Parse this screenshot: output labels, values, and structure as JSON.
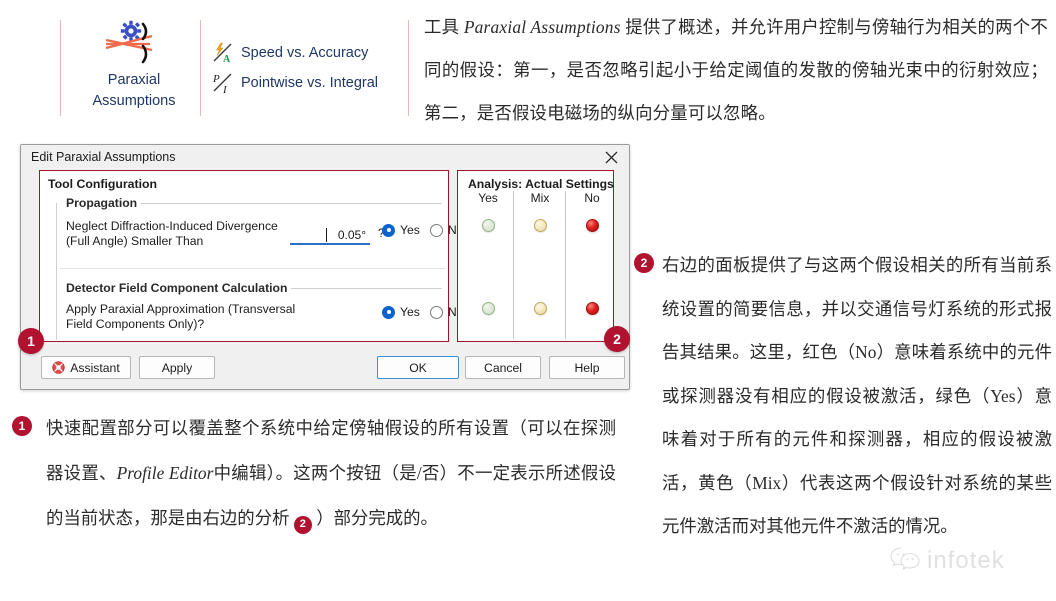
{
  "ribbon": {
    "big_button": {
      "icon": "paraxial-assumptions-icon",
      "line1": "Paraxial",
      "line2": "Assumptions"
    },
    "items": [
      {
        "icon": "speed-accuracy-icon",
        "label": "Speed vs. Accuracy"
      },
      {
        "icon": "pointwise-integral-icon",
        "label": "Pointwise vs. Integral"
      }
    ]
  },
  "intro": {
    "pre": "工具 ",
    "italic": "Paraxial Assumptions",
    "post": " 提供了概述，并允许用户控制与傍轴行为相关的两个不同的假设：第一，是否忽略引起小于给定阈值的发散的傍轴光束中的衍射效应；第二，是否假设电磁场的纵向分量可以忽略。"
  },
  "dialog": {
    "title": "Edit Paraxial Assumptions",
    "close_icon": "close-icon",
    "tool_configuration": {
      "title": "Tool Configuration",
      "propagation": {
        "section_label": "Propagation",
        "question": "Neglect Diffraction-Induced Divergence (Full Angle) Smaller Than",
        "input_value": "0.05°",
        "help_marker": "?",
        "radio_yes": "Yes",
        "radio_no": "No",
        "selected": "Yes"
      },
      "detector": {
        "section_label": "Detector Field Component Calculation",
        "question": "Apply Paraxial Approximation (Transversal Field Components Only)?",
        "radio_yes": "Yes",
        "radio_no": "No",
        "selected": "Yes"
      }
    },
    "analysis": {
      "title": "Analysis: Actual Settings",
      "columns": [
        "Yes",
        "Mix",
        "No"
      ],
      "rows": [
        {
          "name": "propagation-status",
          "yes": "off",
          "mix": "off",
          "no": "on"
        },
        {
          "name": "detector-status",
          "yes": "off",
          "mix": "off",
          "no": "on"
        }
      ]
    },
    "buttons": {
      "assistant": "Assistant",
      "apply": "Apply",
      "ok": "OK",
      "cancel": "Cancel",
      "help": "Help"
    }
  },
  "callouts": {
    "badge_1": "1",
    "badge_2": "2"
  },
  "note_1": {
    "badge": "1",
    "part1": "快速配置部分可以覆盖整个系统中给定傍轴假设的所有设置（可以在探测器设置、",
    "italic": "Profile Editor",
    "part2": "中编辑）。这两个按钮（是/否）不一定表示所述假设的当前状态，那是由右边的分析",
    "inline_badge": "2",
    "part3": "）部分完成的。"
  },
  "note_2": {
    "badge": "2",
    "text": "右边的面板提供了与这两个假设相关的所有当前系统设置的简要信息，并以交通信号灯系统的形式报告其结果。这里，红色（No）意味着系统中的元件或探测器没有相应的假设被激活，绿色（Yes）意味着对于所有的元件和探测器，相应的假设被激活，黄色（Mix）代表这两个假设针对系统的某些元件激活而对其他元件不激活的情况。"
  },
  "watermark": {
    "text": "infotek",
    "icon": "wechat-logo-icon"
  },
  "colors": {
    "accent_red": "#b01230",
    "ribbon_text": "#1f3864",
    "radio_blue": "#0b63ce",
    "light_red": "#e02020",
    "light_green": "#8fb681",
    "light_amber": "#bfa85a"
  }
}
